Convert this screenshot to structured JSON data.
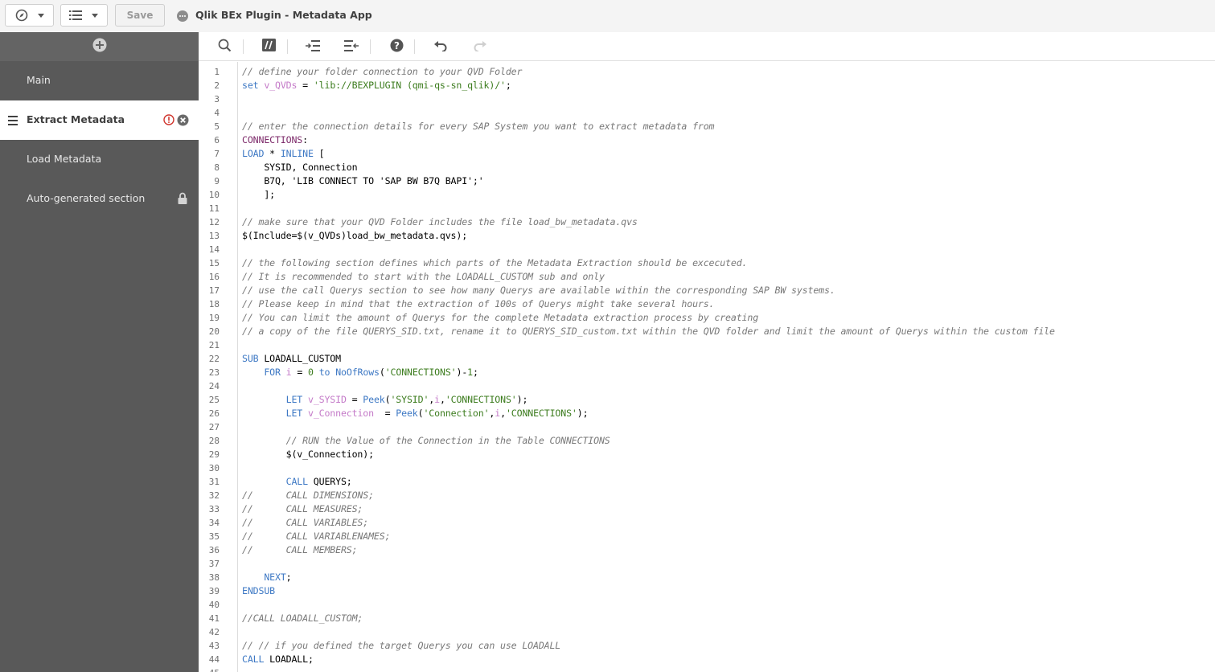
{
  "topbar": {
    "app_title": "Qlik BEx Plugin - Metadata App",
    "save_label": "Save",
    "nav_icon": "compass-icon",
    "list_icon": "list-icon"
  },
  "sidebar": {
    "add_icon": "plus-circle-icon",
    "items": [
      {
        "label": "Main"
      },
      {
        "label": "Extract Metadata",
        "active": true,
        "status": "error"
      },
      {
        "label": "Load Metadata"
      },
      {
        "label": "Auto-generated section",
        "locked": true
      }
    ]
  },
  "toolbar": {
    "icons": [
      "search-icon",
      "comment-icon",
      "indent-icon",
      "outdent-icon",
      "help-icon",
      "undo-icon",
      "redo-icon"
    ]
  },
  "colors": {
    "sidebar_bg": "#595959",
    "comment": "#787878",
    "keyword": "#3d78c4",
    "variable": "#c47ac8",
    "string": "#3c7c1e",
    "table": "#7d2a6a",
    "error": "#d0342c"
  },
  "code": {
    "lines": [
      [
        [
          "c",
          "// define your folder connection to your QVD Folder"
        ]
      ],
      [
        [
          "k",
          "set"
        ],
        [
          "o",
          " "
        ],
        [
          "v",
          "v_QVDs"
        ],
        [
          "o",
          " = "
        ],
        [
          "s",
          "'lib://BEXPLUGIN (qmi-qs-sn_qlik)/'"
        ],
        [
          "o",
          ";"
        ]
      ],
      [],
      [],
      [
        [
          "c",
          "// enter the connection details for every SAP System you want to extract metadata from"
        ]
      ],
      [
        [
          "t",
          "CONNECTIONS"
        ],
        [
          "o",
          ":"
        ]
      ],
      [
        [
          "k",
          "LOAD"
        ],
        [
          "o",
          " * "
        ],
        [
          "k",
          "INLINE"
        ],
        [
          "o",
          " ["
        ]
      ],
      [
        [
          "o",
          "    SYSID, Connection"
        ]
      ],
      [
        [
          "o",
          "    B7Q, 'LIB CONNECT TO 'SAP BW B7Q BAPI';'"
        ]
      ],
      [
        [
          "o",
          "    ];"
        ]
      ],
      [],
      [
        [
          "c",
          "// make sure that your QVD Folder includes the file load_bw_metadata.qvs"
        ]
      ],
      [
        [
          "o",
          "$(Include=$(v_QVDs)load_bw_metadata.qvs);"
        ]
      ],
      [],
      [
        [
          "c",
          "// the following section defines which parts of the Metadata Extraction should be excecuted."
        ]
      ],
      [
        [
          "c",
          "// It is recommended to start with the LOADALL_CUSTOM sub and only"
        ]
      ],
      [
        [
          "c",
          "// use the call Querys section to see how many Querys are available within the corresponding SAP BW systems."
        ]
      ],
      [
        [
          "c",
          "// Please keep in mind that the extraction of 100s of Querys might take several hours."
        ]
      ],
      [
        [
          "c",
          "// You can limit the amount of Querys for the complete Metadata extraction process by creating"
        ]
      ],
      [
        [
          "c",
          "// a copy of the file QUERYS_SID.txt, rename it to QUERYS_SID_custom.txt within the QVD folder and limit the amount of Querys within the custom file"
        ]
      ],
      [],
      [
        [
          "k",
          "SUB"
        ],
        [
          "o",
          " LOADALL_CUSTOM"
        ]
      ],
      [
        [
          "o",
          "    "
        ],
        [
          "k",
          "FOR"
        ],
        [
          "o",
          " "
        ],
        [
          "v",
          "i"
        ],
        [
          "o",
          " = "
        ],
        [
          "n",
          "0"
        ],
        [
          "o",
          " "
        ],
        [
          "k",
          "to"
        ],
        [
          "o",
          " "
        ],
        [
          "f",
          "NoOfRows"
        ],
        [
          "o",
          "("
        ],
        [
          "s",
          "'CONNECTIONS'"
        ],
        [
          "o",
          ")-"
        ],
        [
          "n",
          "1"
        ],
        [
          "o",
          ";"
        ]
      ],
      [],
      [
        [
          "o",
          "        "
        ],
        [
          "k",
          "LET"
        ],
        [
          "o",
          " "
        ],
        [
          "v",
          "v_SYSID"
        ],
        [
          "o",
          " = "
        ],
        [
          "f",
          "Peek"
        ],
        [
          "o",
          "("
        ],
        [
          "s",
          "'SYSID'"
        ],
        [
          "o",
          ","
        ],
        [
          "v",
          "i"
        ],
        [
          "o",
          ","
        ],
        [
          "s",
          "'CONNECTIONS'"
        ],
        [
          "o",
          ");"
        ]
      ],
      [
        [
          "o",
          "        "
        ],
        [
          "k",
          "LET"
        ],
        [
          "o",
          " "
        ],
        [
          "v",
          "v_Connection"
        ],
        [
          "o",
          "  = "
        ],
        [
          "f",
          "Peek"
        ],
        [
          "o",
          "("
        ],
        [
          "s",
          "'Connection'"
        ],
        [
          "o",
          ","
        ],
        [
          "v",
          "i"
        ],
        [
          "o",
          ","
        ],
        [
          "s",
          "'CONNECTIONS'"
        ],
        [
          "o",
          ");"
        ]
      ],
      [],
      [
        [
          "o",
          "        "
        ],
        [
          "c",
          "// RUN the Value of the Connection in the Table CONNECTIONS"
        ]
      ],
      [
        [
          "o",
          "        $(v_Connection);"
        ]
      ],
      [],
      [
        [
          "o",
          "        "
        ],
        [
          "k",
          "CALL"
        ],
        [
          "o",
          " QUERYS;"
        ]
      ],
      [
        [
          "c",
          "//      CALL DIMENSIONS;"
        ]
      ],
      [
        [
          "c",
          "//      CALL MEASURES;"
        ]
      ],
      [
        [
          "c",
          "//      CALL VARIABLES;"
        ]
      ],
      [
        [
          "c",
          "//      CALL VARIABLENAMES;"
        ]
      ],
      [
        [
          "c",
          "//      CALL MEMBERS;"
        ]
      ],
      [],
      [
        [
          "o",
          "    "
        ],
        [
          "k",
          "NEXT"
        ],
        [
          "o",
          ";"
        ]
      ],
      [
        [
          "k",
          "ENDSUB"
        ]
      ],
      [],
      [
        [
          "c",
          "//CALL LOADALL_CUSTOM;"
        ]
      ],
      [],
      [
        [
          "c",
          "// // if you defined the target Querys you can use LOADALL"
        ]
      ],
      [
        [
          "k",
          "CALL"
        ],
        [
          "o",
          " LOADALL;"
        ]
      ],
      []
    ]
  }
}
